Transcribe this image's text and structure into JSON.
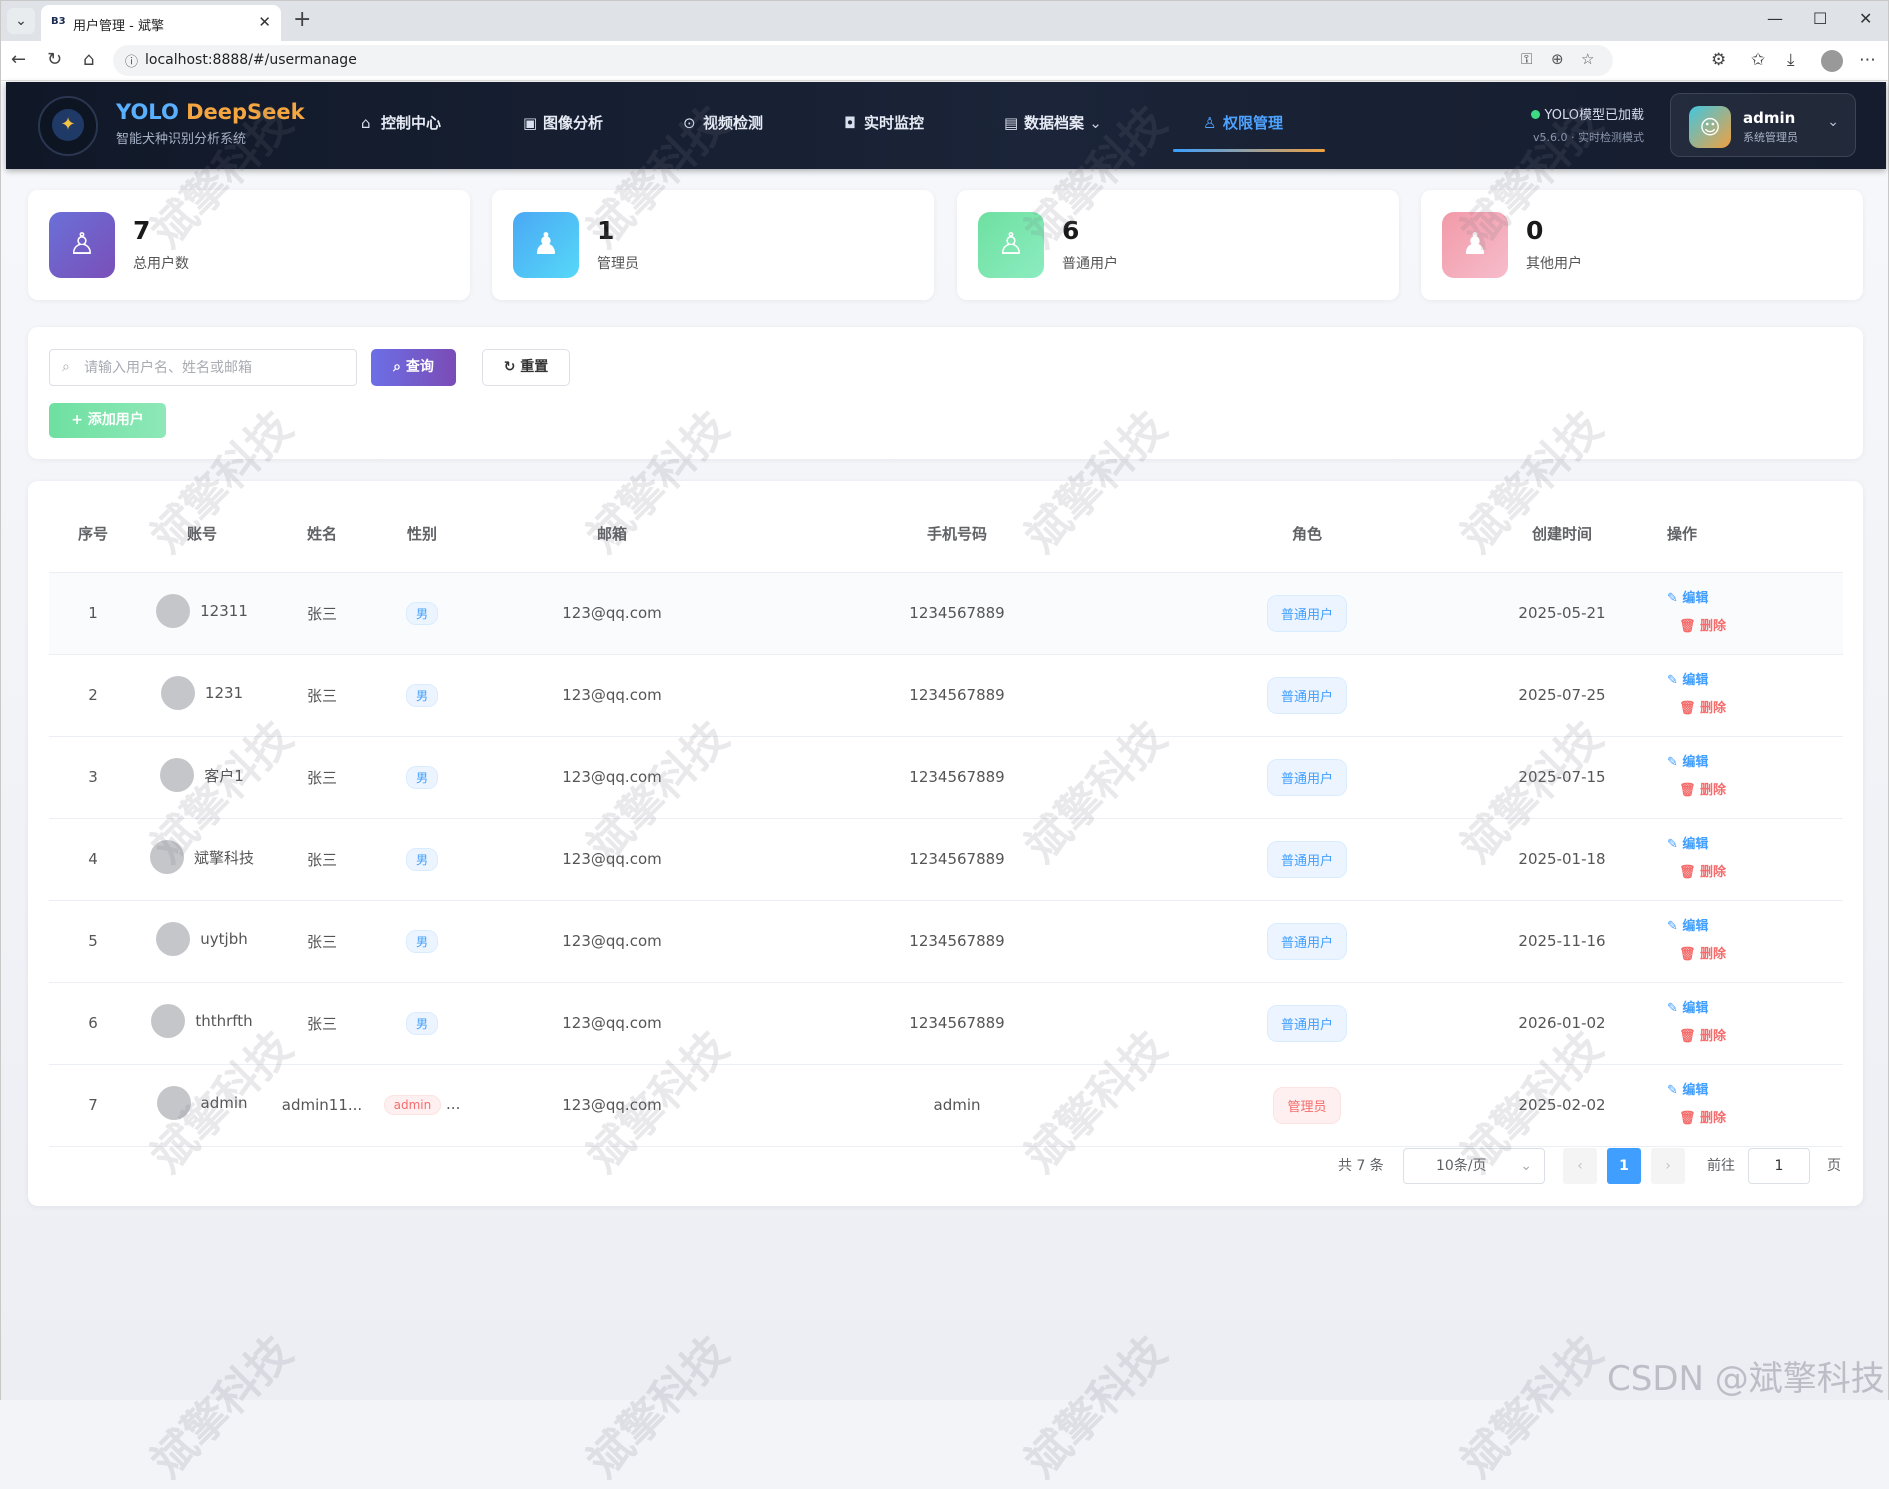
{
  "browser": {
    "tab_title": "用户管理 - 斌擎",
    "tab_favicon": "B3",
    "url": "localhost:8888/#/usermanage"
  },
  "header": {
    "brand_name_a": "YOLO",
    "brand_name_b": "DeepSeek",
    "brand_sub": "智能犬种识别分析系统",
    "nav": [
      "控制中心",
      "图像分析",
      "视频检测",
      "实时监控",
      "数据档案",
      "权限管理"
    ],
    "status_line1": "YOLO模型已加载",
    "status_line2": "v5.6.0 · 实时检测模式",
    "user_name": "admin",
    "user_role": "系统管理员"
  },
  "stats": [
    {
      "value": "7",
      "label": "总用户数",
      "color": "#6a5acd"
    },
    {
      "value": "1",
      "label": "管理员",
      "color": "#4fb0f4"
    },
    {
      "value": "6",
      "label": "普通用户",
      "color": "#6ee0a0"
    },
    {
      "value": "0",
      "label": "其他用户",
      "color": "#f29aa8"
    }
  ],
  "toolbar": {
    "search_placeholder": "请输入用户名、姓名或邮箱",
    "query_label": "查询",
    "reset_label": "重置",
    "add_label": "添加用户"
  },
  "table": {
    "headers": [
      "序号",
      "账号",
      "姓名",
      "性别",
      "邮箱",
      "手机号码",
      "角色",
      "创建时间",
      "操作"
    ],
    "rows": [
      {
        "idx": "1",
        "account": "12311",
        "name": "张三",
        "gender": "男",
        "email": "123@qq.com",
        "phone": "1234567889",
        "role": "普通用户",
        "created": "2025-05-21"
      },
      {
        "idx": "2",
        "account": "1231",
        "name": "张三",
        "gender": "男",
        "email": "123@qq.com",
        "phone": "1234567889",
        "role": "普通用户",
        "created": "2025-07-25"
      },
      {
        "idx": "3",
        "account": "客户1",
        "name": "张三",
        "gender": "男",
        "email": "123@qq.com",
        "phone": "1234567889",
        "role": "普通用户",
        "created": "2025-07-15"
      },
      {
        "idx": "4",
        "account": "斌擎科技",
        "name": "张三",
        "gender": "男",
        "email": "123@qq.com",
        "phone": "1234567889",
        "role": "普通用户",
        "created": "2025-01-18"
      },
      {
        "idx": "5",
        "account": "uytjbh",
        "name": "张三",
        "gender": "男",
        "email": "123@qq.com",
        "phone": "1234567889",
        "role": "普通用户",
        "created": "2025-11-16"
      },
      {
        "idx": "6",
        "account": "ththrfth",
        "name": "张三",
        "gender": "男",
        "email": "123@qq.com",
        "phone": "1234567889",
        "role": "普通用户",
        "created": "2026-01-02"
      },
      {
        "idx": "7",
        "account": "admin",
        "name": "admin11...",
        "gender": "admin",
        "gender_extra": "...",
        "email": "123@qq.com",
        "phone": "admin",
        "role": "管理员",
        "created": "2025-02-02"
      }
    ],
    "edit_label": "编辑",
    "delete_label": "删除"
  },
  "pagination": {
    "total": "共 7 条",
    "page_size": "10条/页",
    "current_page": "1",
    "goto_label": "前往",
    "goto_value": "1",
    "page_suffix": "页"
  },
  "watermark": "斌擎科技",
  "csdn_mark": "CSDN @斌擎科技"
}
